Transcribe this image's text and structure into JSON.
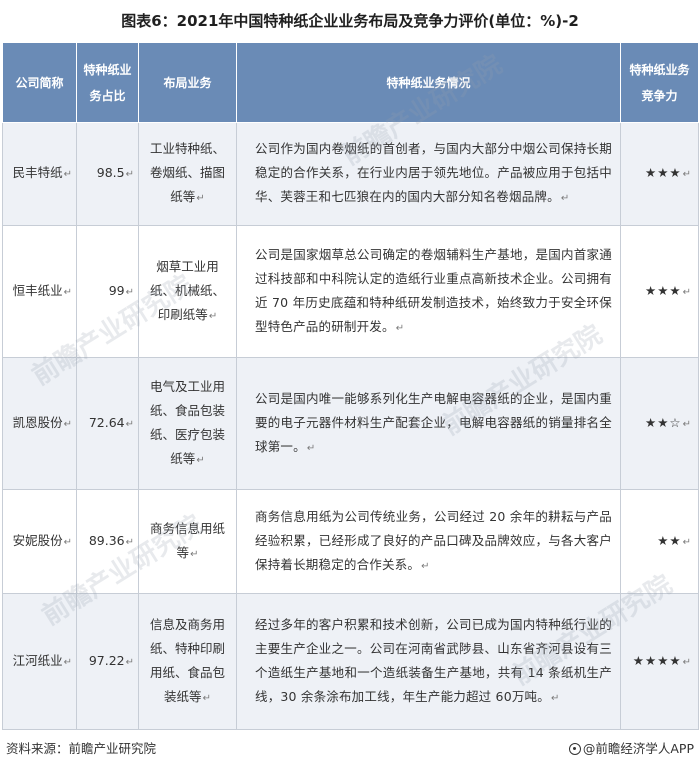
{
  "title": "图表6：2021年中国特种纸企业业务布局及竞争力评价(单位：%)-2",
  "headers": {
    "name": "公司简称",
    "share": "特种纸业务占比",
    "layout": "布局业务",
    "desc": "特种纸业务情况",
    "comp": "特种纸业务竞争力"
  },
  "rows": [
    {
      "name": "民丰特纸",
      "share": "98.5",
      "layout": "工业特种纸、卷烟纸、描图纸等",
      "desc": "公司作为国内卷烟纸的首创者，与国内大部分中烟公司保持长期稳定的合作关系，在行业内居于领先地位。产品被应用于包括中华、芙蓉王和七匹狼在内的国内大部分知名卷烟品牌。",
      "comp": "★★★"
    },
    {
      "name": "恒丰纸业",
      "share": "99",
      "layout": "烟草工业用纸、机械纸、印刷纸等",
      "desc": "公司是国家烟草总公司确定的卷烟辅料生产基地，是国内首家通过科技部和中科院认定的造纸行业重点高新技术企业。公司拥有近 70 年历史底蕴和特种纸研发制造技术，始终致力于安全环保型特色产品的研制开发。",
      "comp": "★★★"
    },
    {
      "name": "凯恩股份",
      "share": "72.64",
      "layout": "电气及工业用纸、食品包装纸、医疗包装纸等",
      "desc": "公司是国内唯一能够系列化生产电解电容器纸的企业，是国内重要的电子元器件材料生产配套企业，电解电容器纸的销量排名全球第一。",
      "comp": "★★☆"
    },
    {
      "name": "安妮股份",
      "share": "89.36",
      "layout": "商务信息用纸等",
      "desc": "商务信息用纸为公司传统业务，公司经过 20 余年的耕耘与产品经验积累，已经形成了良好的产品口碑及品牌效应，与各大客户保持着长期稳定的合作关系。",
      "comp": "★★"
    },
    {
      "name": "江河纸业",
      "share": "97.22",
      "layout": "信息及商务用纸、特种印刷用纸、食品包装纸等",
      "desc": "经过多年的客户积累和技术创新，公司已成为国内特种纸行业的主要生产企业之一。公司在河南省武陟县、山东省齐河县设有三个造纸生产基地和一个造纸装备生产基地，共有 14 条纸机生产线，30 余条涂布加工线，年生产能力超过 60万吨。",
      "comp": "★★★★"
    }
  ],
  "mark": "↵",
  "watermark": "前瞻产业研究院",
  "footer": {
    "source": "资料来源：前瞻产业研究院",
    "brand": "@前瞻经济学人APP"
  }
}
